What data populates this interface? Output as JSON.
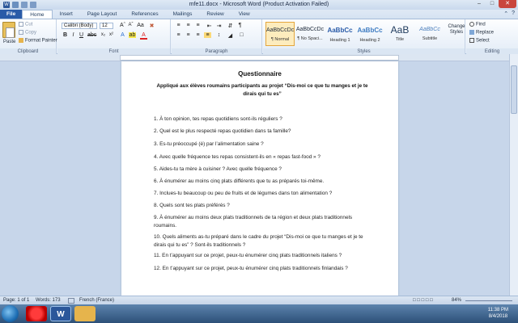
{
  "window": {
    "title": "mfe11.docx - Microsoft Word (Product Activation Failed)",
    "app_icon": "W"
  },
  "tabs": [
    "File",
    "Home",
    "Insert",
    "Page Layout",
    "References",
    "Mailings",
    "Review",
    "View"
  ],
  "active_tab": "Home",
  "ribbon": {
    "clipboard": {
      "paste": "Paste",
      "cut": "Cut",
      "copy": "Copy",
      "format_painter": "Format Painter",
      "label": "Clipboard"
    },
    "font": {
      "name": "Calibri (Body)",
      "size": "12",
      "label": "Font"
    },
    "paragraph": {
      "label": "Paragraph"
    },
    "styles": {
      "items": [
        {
          "sample": "AaBbCcDc",
          "name": "¶ Normal"
        },
        {
          "sample": "AaBbCcDc",
          "name": "¶ No Spaci..."
        },
        {
          "sample": "AaBbCc",
          "name": "Heading 1"
        },
        {
          "sample": "AaBbCc",
          "name": "Heading 2"
        },
        {
          "sample": "AaB",
          "name": "Title"
        },
        {
          "sample": "AaBbCc",
          "name": "Subtitle"
        }
      ],
      "change_styles": "Change Styles",
      "label": "Styles"
    },
    "editing": {
      "find": "Find",
      "replace": "Replace",
      "select": "Select",
      "label": "Editing"
    }
  },
  "document": {
    "title": "Questionnaire",
    "subtitle": "Appliqué aux élèves roumains participants au projet “Dis-moi ce que tu manges et je te dirais qui tu es”",
    "questions": [
      "1. À ton opinion, tes repas quotidiens sont-ils réguliers ?",
      "2. Quel est le plus respecté repas quotidien dans ta famille?",
      "3. Es-tu préoccupé (é) par l’alimentation  saine ?",
      "4. Avec quelle fréquence tes repas consistent-ils en « repas fast-food » ?",
      "5. Aides-tu  ta mère à cuisiner ? Avec quelle fréquence ?",
      "6. À énumérer au moins  cinq plats différents que tu as préparés toi-même.",
      "7. Inclues-tu beaucoup ou peu de fruits et de légumes dans ton alimentation ?",
      "8. Quels sont tes plats préférés ?",
      "9. À énumérer au moins  deux plats traditionnels de ta région et deux plats traditionnels roumains.",
      "10. Quels aliments as-tu préparé dans le cadre du projet “Dis-moi ce que tu manges et je te dirais qui tu es” ? Sont-ils traditionnels ?",
      "11. En t’appuyant sur ce projet, peux-tu énumérer cinq plats traditionnels italiens ?",
      "12. En t’appuyant sur ce projet, peux-tu énumérer cinq plats traditionnels finlandais ?"
    ]
  },
  "status": {
    "page": "Page: 1 of 1",
    "words": "Words: 173",
    "language": "French (France)",
    "zoom": "84%"
  },
  "taskbar": {
    "time": "11:38 PM",
    "date": "8/4/2018"
  },
  "colors": {
    "file_tab": "#2a5ba8",
    "ribbon_bg": "#e3ecf7",
    "taskbar": "#2d5078"
  }
}
